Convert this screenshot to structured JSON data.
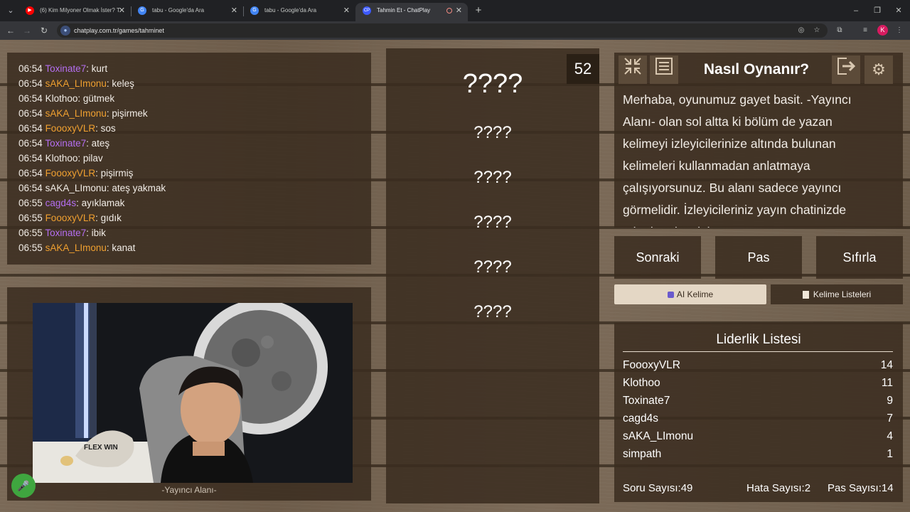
{
  "browser": {
    "tabs": [
      {
        "title": "(6) Kim Milyoner Olmak İster? T",
        "icon": "youtube-icon",
        "icon_color": "#ff0000"
      },
      {
        "title": "tabu - Google'da Ara",
        "icon": "google-icon",
        "icon_color": "#4285f4"
      },
      {
        "title": "tabu - Google'da Ara",
        "icon": "google-icon",
        "icon_color": "#4285f4"
      },
      {
        "title": "Tahmin Et - ChatPlay",
        "icon": "chatplay-icon",
        "icon_color": "#3d5afe",
        "active": true
      }
    ],
    "url": "chatplay.com.tr/games/tahminet",
    "profile_initial": "K"
  },
  "chat": {
    "messages": [
      {
        "time": "06:54",
        "user": "Toxinate7",
        "user_color": "#b46ef0",
        "text": ": kurt"
      },
      {
        "time": "06:54",
        "user": "sAKA_LImonu",
        "user_color": "#f0a030",
        "text": ": keleş"
      },
      {
        "time": "06:54",
        "user": "Klothoo",
        "user_color": "#f1ece6",
        "text": ": gütmek"
      },
      {
        "time": "06:54",
        "user": "sAKA_LImonu",
        "user_color": "#f0a030",
        "text": ": pişirmek"
      },
      {
        "time": "06:54",
        "user": "FoooxyVLR",
        "user_color": "#f0a030",
        "text": ": sos"
      },
      {
        "time": "06:54",
        "user": "Toxinate7",
        "user_color": "#b46ef0",
        "text": ": ateş"
      },
      {
        "time": "06:54",
        "user": "Klothoo",
        "user_color": "#f1ece6",
        "text": ": pilav"
      },
      {
        "time": "06:54",
        "user": "FoooxyVLR",
        "user_color": "#f0a030",
        "text": ": pişirmiş"
      },
      {
        "time": "06:54",
        "user": "sAKA_LImonu",
        "user_color": "#f1ece6",
        "text": ": ateş yakmak"
      },
      {
        "time": "06:55",
        "user": "cagd4s",
        "user_color": "#b46ef0",
        "text": ": ayıklamak"
      },
      {
        "time": "06:55",
        "user": "FoooxyVLR",
        "user_color": "#f0a030",
        "text": ": gıdık"
      },
      {
        "time": "06:55",
        "user": "Toxinate7",
        "user_color": "#b46ef0",
        "text": ": ibik"
      },
      {
        "time": "06:55",
        "user": "sAKA_LImonu",
        "user_color": "#f0a030",
        "text": ": kanat"
      }
    ]
  },
  "streamer": {
    "label": "-Yayıncı Alanı-",
    "mic_icon": "microphone-icon"
  },
  "game": {
    "timer": "52",
    "main_word": "????",
    "forbidden_words": [
      "????",
      "????",
      "????",
      "????",
      "????"
    ]
  },
  "howto": {
    "title": "Nasıl Oynanır?",
    "text": "Merhaba, oyunumuz gayet basit. -Yayıncı Alanı- olan sol altta ki bölüm de yazan kelimeyi izleyicilerinize altında bulunan kelimeleri kullanmadan anlatmaya çalışıyorsunuz. Bu alanı sadece yayıncı görmelidir. İzleyicileriniz yayın chatinizde tahmin edecektir.",
    "icons": [
      "collapse-icon",
      "notes-icon",
      "exit-icon",
      "settings-icon"
    ]
  },
  "actions": {
    "next": "Sonraki",
    "pass": "Pas",
    "reset": "Sıfırla",
    "ai_word": "AI Kelime",
    "word_lists": "Kelime Listeleri"
  },
  "leaderboard": {
    "title": "Liderlik Listesi",
    "entries": [
      {
        "name": "FoooxyVLR",
        "score": "14"
      },
      {
        "name": "Klothoo",
        "score": "11"
      },
      {
        "name": "Toxinate7",
        "score": "9"
      },
      {
        "name": "cagd4s",
        "score": "7"
      },
      {
        "name": "sAKA_LImonu",
        "score": "4"
      },
      {
        "name": "simpath",
        "score": "1"
      }
    ],
    "questions_label": "Soru Sayısı:",
    "questions": "49",
    "errors_label": "Hata Sayısı:",
    "errors": "2",
    "passes_label": "Pas Sayısı:",
    "passes": "14"
  }
}
